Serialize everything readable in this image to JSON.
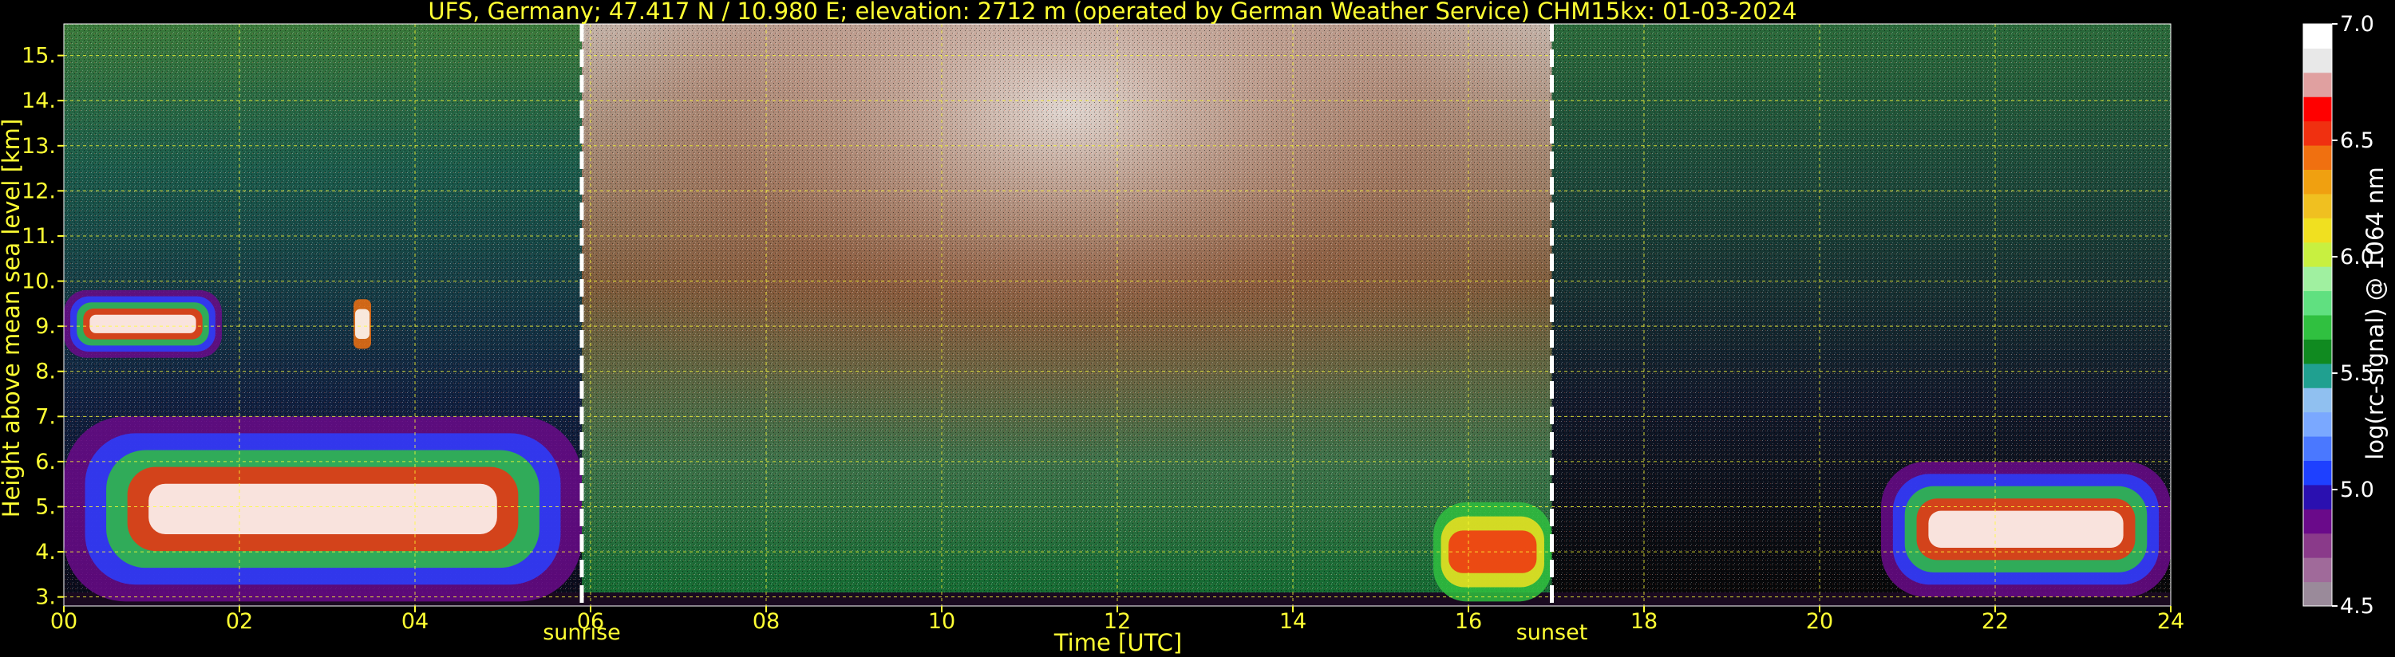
{
  "title": "UFS, Germany; 47.417 N / 10.980 E; elevation: 2712 m  (operated by German Weather Service)    CHM15kx: 01-03-2024",
  "chart_data": {
    "type": "heatmap",
    "title": "UFS, Germany; 47.417 N / 10.980 E; elevation: 2712 m  (operated by German Weather Service)    CHM15kx: 01-03-2024",
    "xlabel": "Time [UTC]",
    "ylabel": "Height above mean sea level [km]",
    "xlim": [
      0,
      24
    ],
    "ylim": [
      2.8,
      15.7
    ],
    "xticks": [
      0,
      2,
      4,
      6,
      8,
      10,
      12,
      14,
      16,
      18,
      20,
      22,
      24
    ],
    "xtick_labels": [
      "00",
      "02",
      "04",
      "06",
      "08",
      "10",
      "12",
      "14",
      "16",
      "18",
      "20",
      "22",
      "24"
    ],
    "yticks": [
      3,
      4,
      5,
      6,
      7,
      8,
      9,
      10,
      11,
      12,
      13,
      14,
      15
    ],
    "ytick_labels": [
      "3.",
      "4.",
      "5.",
      "6.",
      "7.",
      "8.",
      "9.",
      "10.",
      "11.",
      "12.",
      "13.",
      "14.",
      "15."
    ],
    "grid": true,
    "colorbar": {
      "label": "log(rc-signal) @ 1064 nm",
      "range": [
        4.5,
        7.0
      ],
      "ticks": [
        4.5,
        5.0,
        5.5,
        6.0,
        6.5,
        7.0
      ],
      "tick_labels": [
        "4.5",
        "5.0",
        "5.5",
        "6.0",
        "6.5",
        "7.0"
      ],
      "colors": [
        "#9a8a9a",
        "#a06a9a",
        "#8a3a8a",
        "#6a0a8a",
        "#2a10b0",
        "#1e40ff",
        "#4a78ff",
        "#7aa8ff",
        "#90c0f0",
        "#20a090",
        "#108a20",
        "#30c040",
        "#60e080",
        "#a0f0a0",
        "#c8f040",
        "#f0e020",
        "#f0c020",
        "#f0a010",
        "#f07010",
        "#f03010",
        "#ff0000",
        "#e0a0a0",
        "#e8e8e8",
        "#ffffff"
      ]
    },
    "annotations": [
      {
        "text": "sunrise",
        "x": 5.9
      },
      {
        "text": "sunset",
        "x": 16.95
      }
    ],
    "features": [
      {
        "kind": "cloud layer",
        "time": [
          0,
          1.8
        ],
        "height": [
          8.3,
          9.8
        ]
      },
      {
        "kind": "cloud",
        "time": [
          3.3,
          3.5
        ],
        "height": [
          8.5,
          9.6
        ]
      },
      {
        "kind": "cloud layer",
        "time": [
          0,
          5.9
        ],
        "height": [
          2.9,
          7.0
        ]
      },
      {
        "kind": "boundary layer",
        "time": [
          15.6,
          16.95
        ],
        "height": [
          2.9,
          5.1
        ]
      },
      {
        "kind": "cloud layer",
        "time": [
          20.7,
          24
        ],
        "height": [
          3.0,
          6.0
        ]
      }
    ]
  }
}
